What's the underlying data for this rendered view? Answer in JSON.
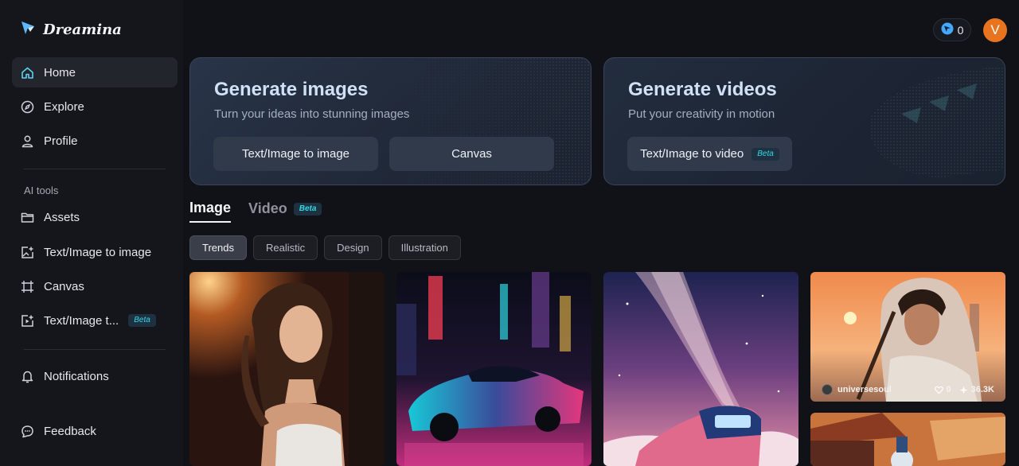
{
  "brand": {
    "name": "Dreamina"
  },
  "nav": {
    "home": "Home",
    "explore": "Explore",
    "profile": "Profile",
    "section_label": "AI tools",
    "assets": "Assets",
    "text_image_to_image": "Text/Image to image",
    "canvas": "Canvas",
    "text_image_to_video": "Text/Image t...",
    "beta": "Beta",
    "notifications": "Notifications",
    "feedback": "Feedback"
  },
  "topbar": {
    "credits": "0",
    "avatar_initial": "V"
  },
  "hero_images": {
    "title": "Generate images",
    "subtitle": "Turn your ideas into stunning images",
    "btn_text_image": "Text/Image to image",
    "btn_canvas": "Canvas"
  },
  "hero_videos": {
    "title": "Generate videos",
    "subtitle": "Put your creativity in motion",
    "btn_video": "Text/Image to video",
    "beta": "Beta"
  },
  "tabs": {
    "image": "Image",
    "video": "Video",
    "beta": "Beta"
  },
  "chips": [
    "Trends",
    "Realistic",
    "Design",
    "Illustration"
  ],
  "gallery": {
    "card4": {
      "author": "universesoul",
      "likes": "0",
      "uses": "36.3K"
    }
  },
  "colors": {
    "accent": "#35d7e6",
    "avatar": "#e8741f",
    "background": "#111217"
  }
}
